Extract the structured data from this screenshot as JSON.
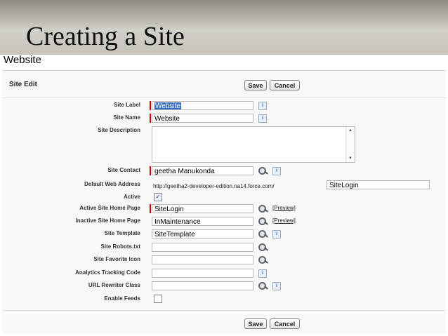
{
  "slide": {
    "title": "Creating a Site"
  },
  "page": {
    "heading": "Website"
  },
  "panel": {
    "title": "Site Edit"
  },
  "buttons": {
    "save": "Save",
    "cancel": "Cancel"
  },
  "fields": {
    "site_label": {
      "label": "Site Label",
      "value": "Website"
    },
    "site_name": {
      "label": "Site Name",
      "value": "Website"
    },
    "site_description": {
      "label": "Site Description",
      "value": ""
    },
    "site_contact": {
      "label": "Site Contact",
      "value": "geetha Manukonda"
    },
    "default_web_address": {
      "label": "Default Web Address",
      "prefix": "http://geetha2-developer-edition.na14.force.com/",
      "value": "SiteLogin"
    },
    "active": {
      "label": "Active",
      "checked": true
    },
    "active_home": {
      "label": "Active Site Home Page",
      "value": "SiteLogin",
      "preview": "[Preview]"
    },
    "inactive_home": {
      "label": "Inactive Site Home Page",
      "value": "InMaintenance",
      "preview": "[Preview]"
    },
    "site_template": {
      "label": "Site Template",
      "value": "SiteTemplate"
    },
    "robots": {
      "label": "Site Robots.txt",
      "value": ""
    },
    "favicon": {
      "label": "Site Favorite Icon",
      "value": ""
    },
    "analytics": {
      "label": "Analytics Tracking Code",
      "value": ""
    },
    "rewriter": {
      "label": "URL Rewriter Class",
      "value": ""
    },
    "feeds": {
      "label": "Enable Feeds",
      "checked": false
    }
  },
  "icons": {
    "info": "i",
    "scroll_up": "▲",
    "scroll_down": "▼",
    "check": "✓"
  }
}
